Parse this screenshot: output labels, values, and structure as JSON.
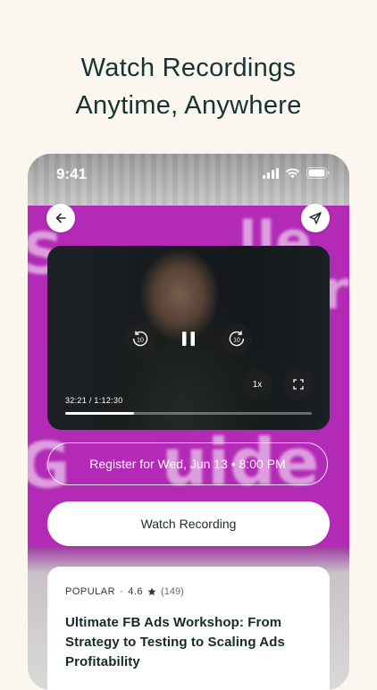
{
  "headline": {
    "line1": "Watch Recordings",
    "line2": "Anytime, Anywhere"
  },
  "status_bar": {
    "time": "9:41"
  },
  "video": {
    "timecode": "32:21 / 1:12:30",
    "progress": 0.28,
    "speed_label": "1x",
    "rewind_label": "10",
    "forward_label": "10"
  },
  "actions": {
    "register_label": "Register for Wed, Jun 13 • 8:00 PM",
    "watch_label": "Watch Recording"
  },
  "card": {
    "tag": "POPULAR",
    "separator": "·",
    "rating": "4.6",
    "review_count": "(149)",
    "title": "Ultimate FB Ads Workshop: From Strategy to Testing to Scaling Ads Profitability"
  },
  "colors": {
    "accent_magenta": "#b22ab6",
    "headline_text": "#173434",
    "page_background": "#fbf6ee"
  },
  "icons": {
    "back": "arrow-left-icon",
    "share": "send-icon",
    "pause": "pause-icon",
    "fullscreen": "fullscreen-icon"
  }
}
